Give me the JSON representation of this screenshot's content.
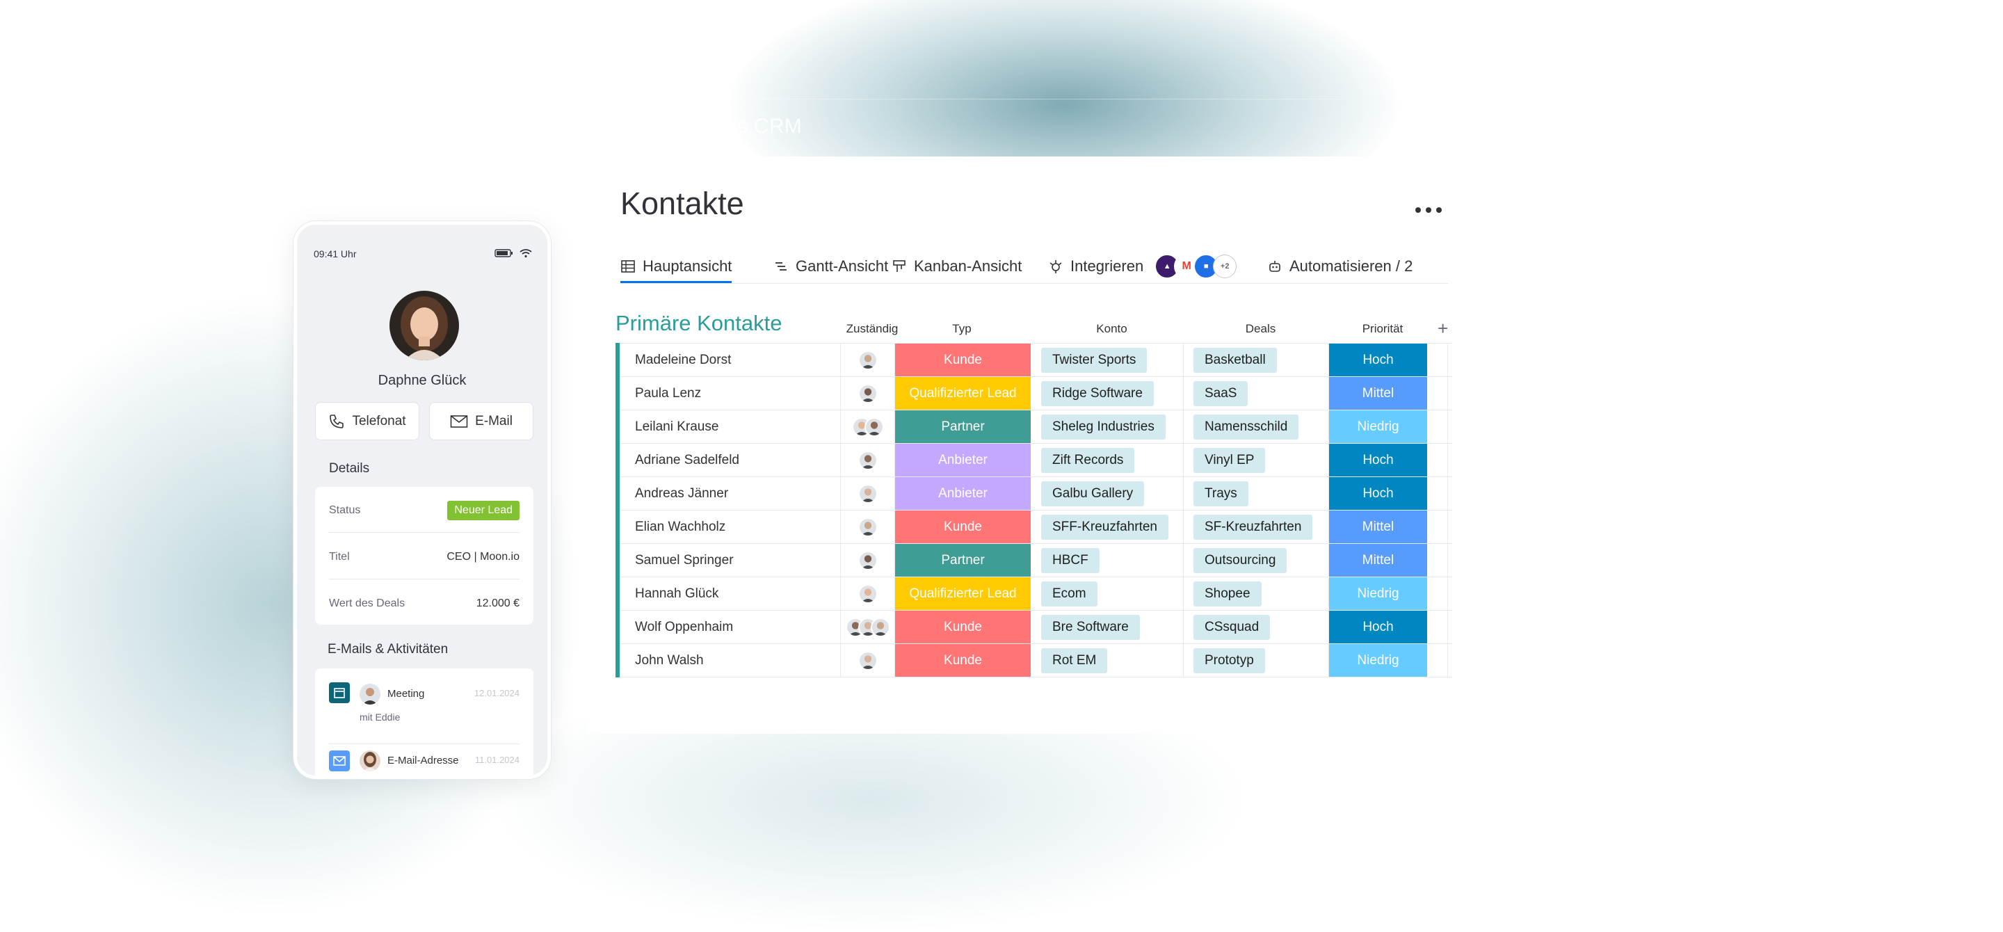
{
  "brand": {
    "text": "monday sales CRM"
  },
  "board": {
    "title": "Kontakte",
    "more_icon": "more-horizontal-icon",
    "tabs": [
      {
        "label": "Hauptansicht",
        "icon": "table-icon",
        "active": true
      },
      {
        "label": "Gantt-Ansicht",
        "icon": "gantt-icon",
        "active": false
      },
      {
        "label": "Kanban-Ansicht",
        "icon": "kanban-icon",
        "active": false
      },
      {
        "label": "Integrieren",
        "icon": "integrate-icon",
        "active": false,
        "extra_count": "+2"
      },
      {
        "label": "Automatisieren / 2",
        "icon": "robot-icon",
        "active": false
      }
    ],
    "group": {
      "title": "Primäre Kontakte",
      "color": "#2a9d9a",
      "columns": [
        "Zuständig",
        "Typ",
        "Konto",
        "Deals",
        "Priorität"
      ],
      "add_column_label": "+",
      "rows": [
        {
          "name": "Madeleine Dorst",
          "owners": 1,
          "type": "Kunde",
          "account": "Twister Sports",
          "deal": "Basketball",
          "priority": "Hoch"
        },
        {
          "name": "Paula Lenz",
          "owners": 1,
          "type": "Qualifizierter Lead",
          "account": "Ridge Software",
          "deal": "SaaS",
          "priority": "Mittel"
        },
        {
          "name": "Leilani Krause",
          "owners": 2,
          "type": "Partner",
          "account": "Sheleg Industries",
          "deal": "Namensschild",
          "priority": "Niedrig"
        },
        {
          "name": "Adriane Sadelfeld",
          "owners": 1,
          "type": "Anbieter",
          "account": "Zift Records",
          "deal": "Vinyl EP",
          "priority": "Hoch"
        },
        {
          "name": "Andreas Jänner",
          "owners": 1,
          "type": "Anbieter",
          "account": "Galbu Gallery",
          "deal": "Trays",
          "priority": "Hoch"
        },
        {
          "name": "Elian Wachholz",
          "owners": 1,
          "type": "Kunde",
          "account": "SFF-Kreuzfahrten",
          "deal": "SF-Kreuzfahrten",
          "priority": "Mittel"
        },
        {
          "name": "Samuel Springer",
          "owners": 1,
          "type": "Partner",
          "account": "HBCF",
          "deal": "Outsourcing",
          "priority": "Mittel"
        },
        {
          "name": "Hannah Glück",
          "owners": 1,
          "type": "Qualifizierter Lead",
          "account": "Ecom",
          "deal": "Shopee",
          "priority": "Niedrig"
        },
        {
          "name": "Wolf Oppenhaim",
          "owners": 3,
          "type": "Kunde",
          "account": "Bre Software",
          "deal": "CSsquad",
          "priority": "Hoch"
        },
        {
          "name": "John Walsh",
          "owners": 1,
          "type": "Kunde",
          "account": "Rot EM",
          "deal": "Prototyp",
          "priority": "Niedrig"
        }
      ]
    },
    "type_colors": {
      "Kunde": "#ff7575",
      "Qualifizierter Lead": "#ffcb00",
      "Partner": "#3e9e96",
      "Anbieter": "#c4a8ff"
    },
    "priority_colors": {
      "Hoch": "#0086c0",
      "Mittel": "#579bfc",
      "Niedrig": "#66ccff"
    }
  },
  "phone": {
    "time": "09:41 Uhr",
    "contact_name": "Daphne Glück",
    "call_label": "Telefonat",
    "email_label": "E-Mail",
    "details_title": "Details",
    "details": {
      "status_label": "Status",
      "status_value": "Neuer Lead",
      "title_label": "Titel",
      "title_value": "CEO | Moon.io",
      "deal_label": "Wert des Deals",
      "deal_value": "12.000 €"
    },
    "activities_title": "E-Mails & Aktivitäten",
    "activities": [
      {
        "icon": "calendar-icon",
        "title": "Meeting",
        "subtitle": "mit Eddie",
        "date": "12.01.2024"
      },
      {
        "icon": "mail-icon",
        "title": "E-Mail-Adresse",
        "subtitle": "",
        "date": "11.01.2024"
      }
    ]
  }
}
